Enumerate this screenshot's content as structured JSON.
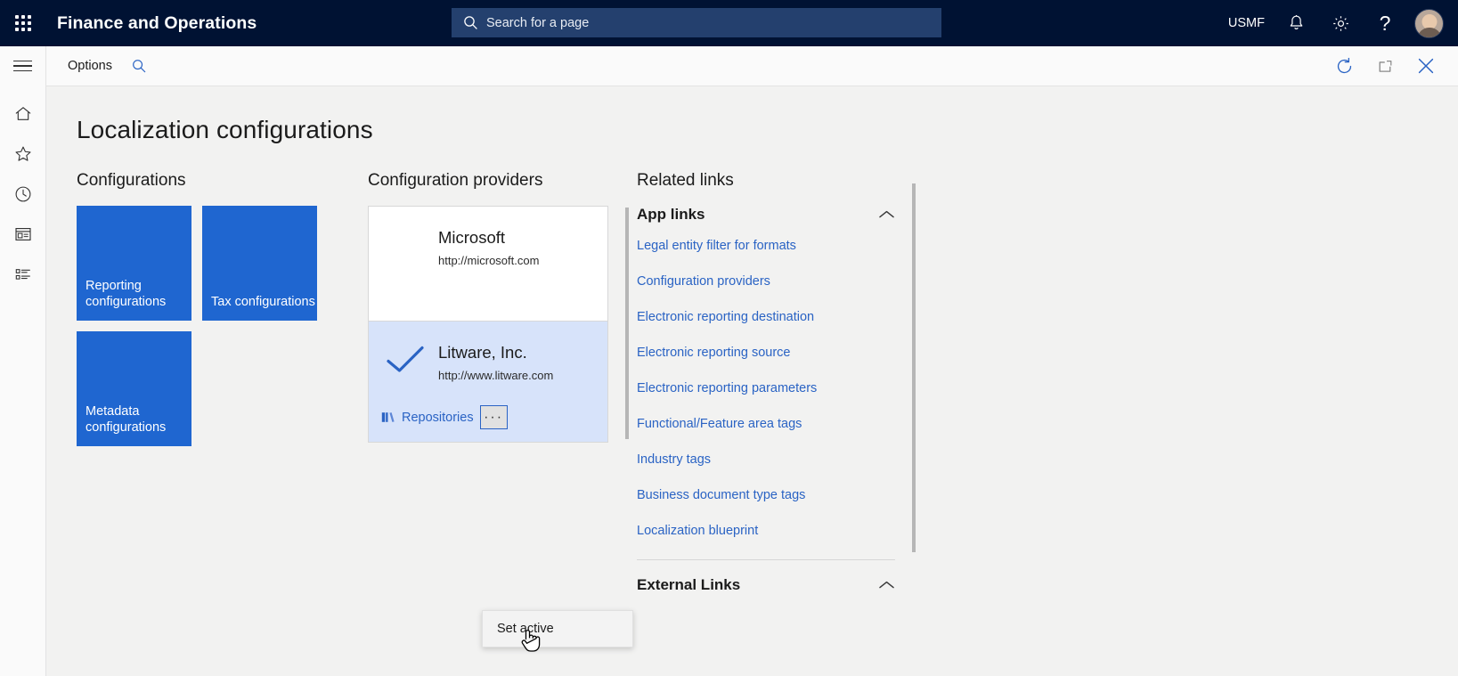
{
  "topbar": {
    "waffle_icon": "app-launcher-icon",
    "app_title": "Finance and Operations",
    "search": {
      "icon": "search-icon",
      "placeholder": "Search for a page",
      "value": ""
    },
    "company": "USMF",
    "notifications_icon": "bell-icon",
    "settings_icon": "gear-icon",
    "help_label": "?",
    "avatar": "user-avatar"
  },
  "commandbar": {
    "hamburger_icon": "hamburger-menu-icon",
    "options_label": "Options",
    "search_icon": "search-icon",
    "refresh_icon": "refresh-icon",
    "popout_icon": "open-in-new-window-icon",
    "close_icon": "close-icon"
  },
  "leftrail": {
    "items": [
      {
        "icon": "home-icon",
        "name": "home"
      },
      {
        "icon": "star-icon",
        "name": "favorites"
      },
      {
        "icon": "clock-icon",
        "name": "recent"
      },
      {
        "icon": "workspaces-icon",
        "name": "workspaces"
      },
      {
        "icon": "list-icon",
        "name": "modules"
      }
    ]
  },
  "page": {
    "title": "Localization configurations"
  },
  "configurations": {
    "heading": "Configurations",
    "tile_color": "#1f66d0",
    "tiles": [
      {
        "label": "Reporting configurations"
      },
      {
        "label": "Tax configurations"
      },
      {
        "label": "Metadata configurations"
      }
    ]
  },
  "providers": {
    "heading": "Configuration providers",
    "items": [
      {
        "name": "Microsoft",
        "url": "http://microsoft.com",
        "active": false,
        "checkmark": false
      },
      {
        "name": "Litware, Inc.",
        "url": "http://www.litware.com",
        "active": true,
        "checkmark": true,
        "repositories_label": "Repositories",
        "repositories_icon": "books-icon",
        "overflow_label": "···"
      }
    ],
    "context_menu": {
      "items": [
        {
          "label": "Set active"
        }
      ]
    }
  },
  "related": {
    "heading": "Related links",
    "groups": [
      {
        "title": "App links",
        "chevron": "chevron-up-icon",
        "links": [
          "Legal entity filter for formats",
          "Configuration providers",
          "Electronic reporting destination",
          "Electronic reporting source",
          "Electronic reporting parameters",
          "Functional/Feature area tags",
          "Industry tags",
          "Business document type tags",
          "Localization blueprint"
        ]
      },
      {
        "title": "External Links",
        "chevron": "chevron-up-icon",
        "links": []
      }
    ]
  },
  "colors": {
    "nav_background": "#001233",
    "accent_blue": "#1f66d0",
    "link_blue": "#2a63c4",
    "selected_row": "#d7e3fa",
    "page_background": "#f2f2f1"
  }
}
